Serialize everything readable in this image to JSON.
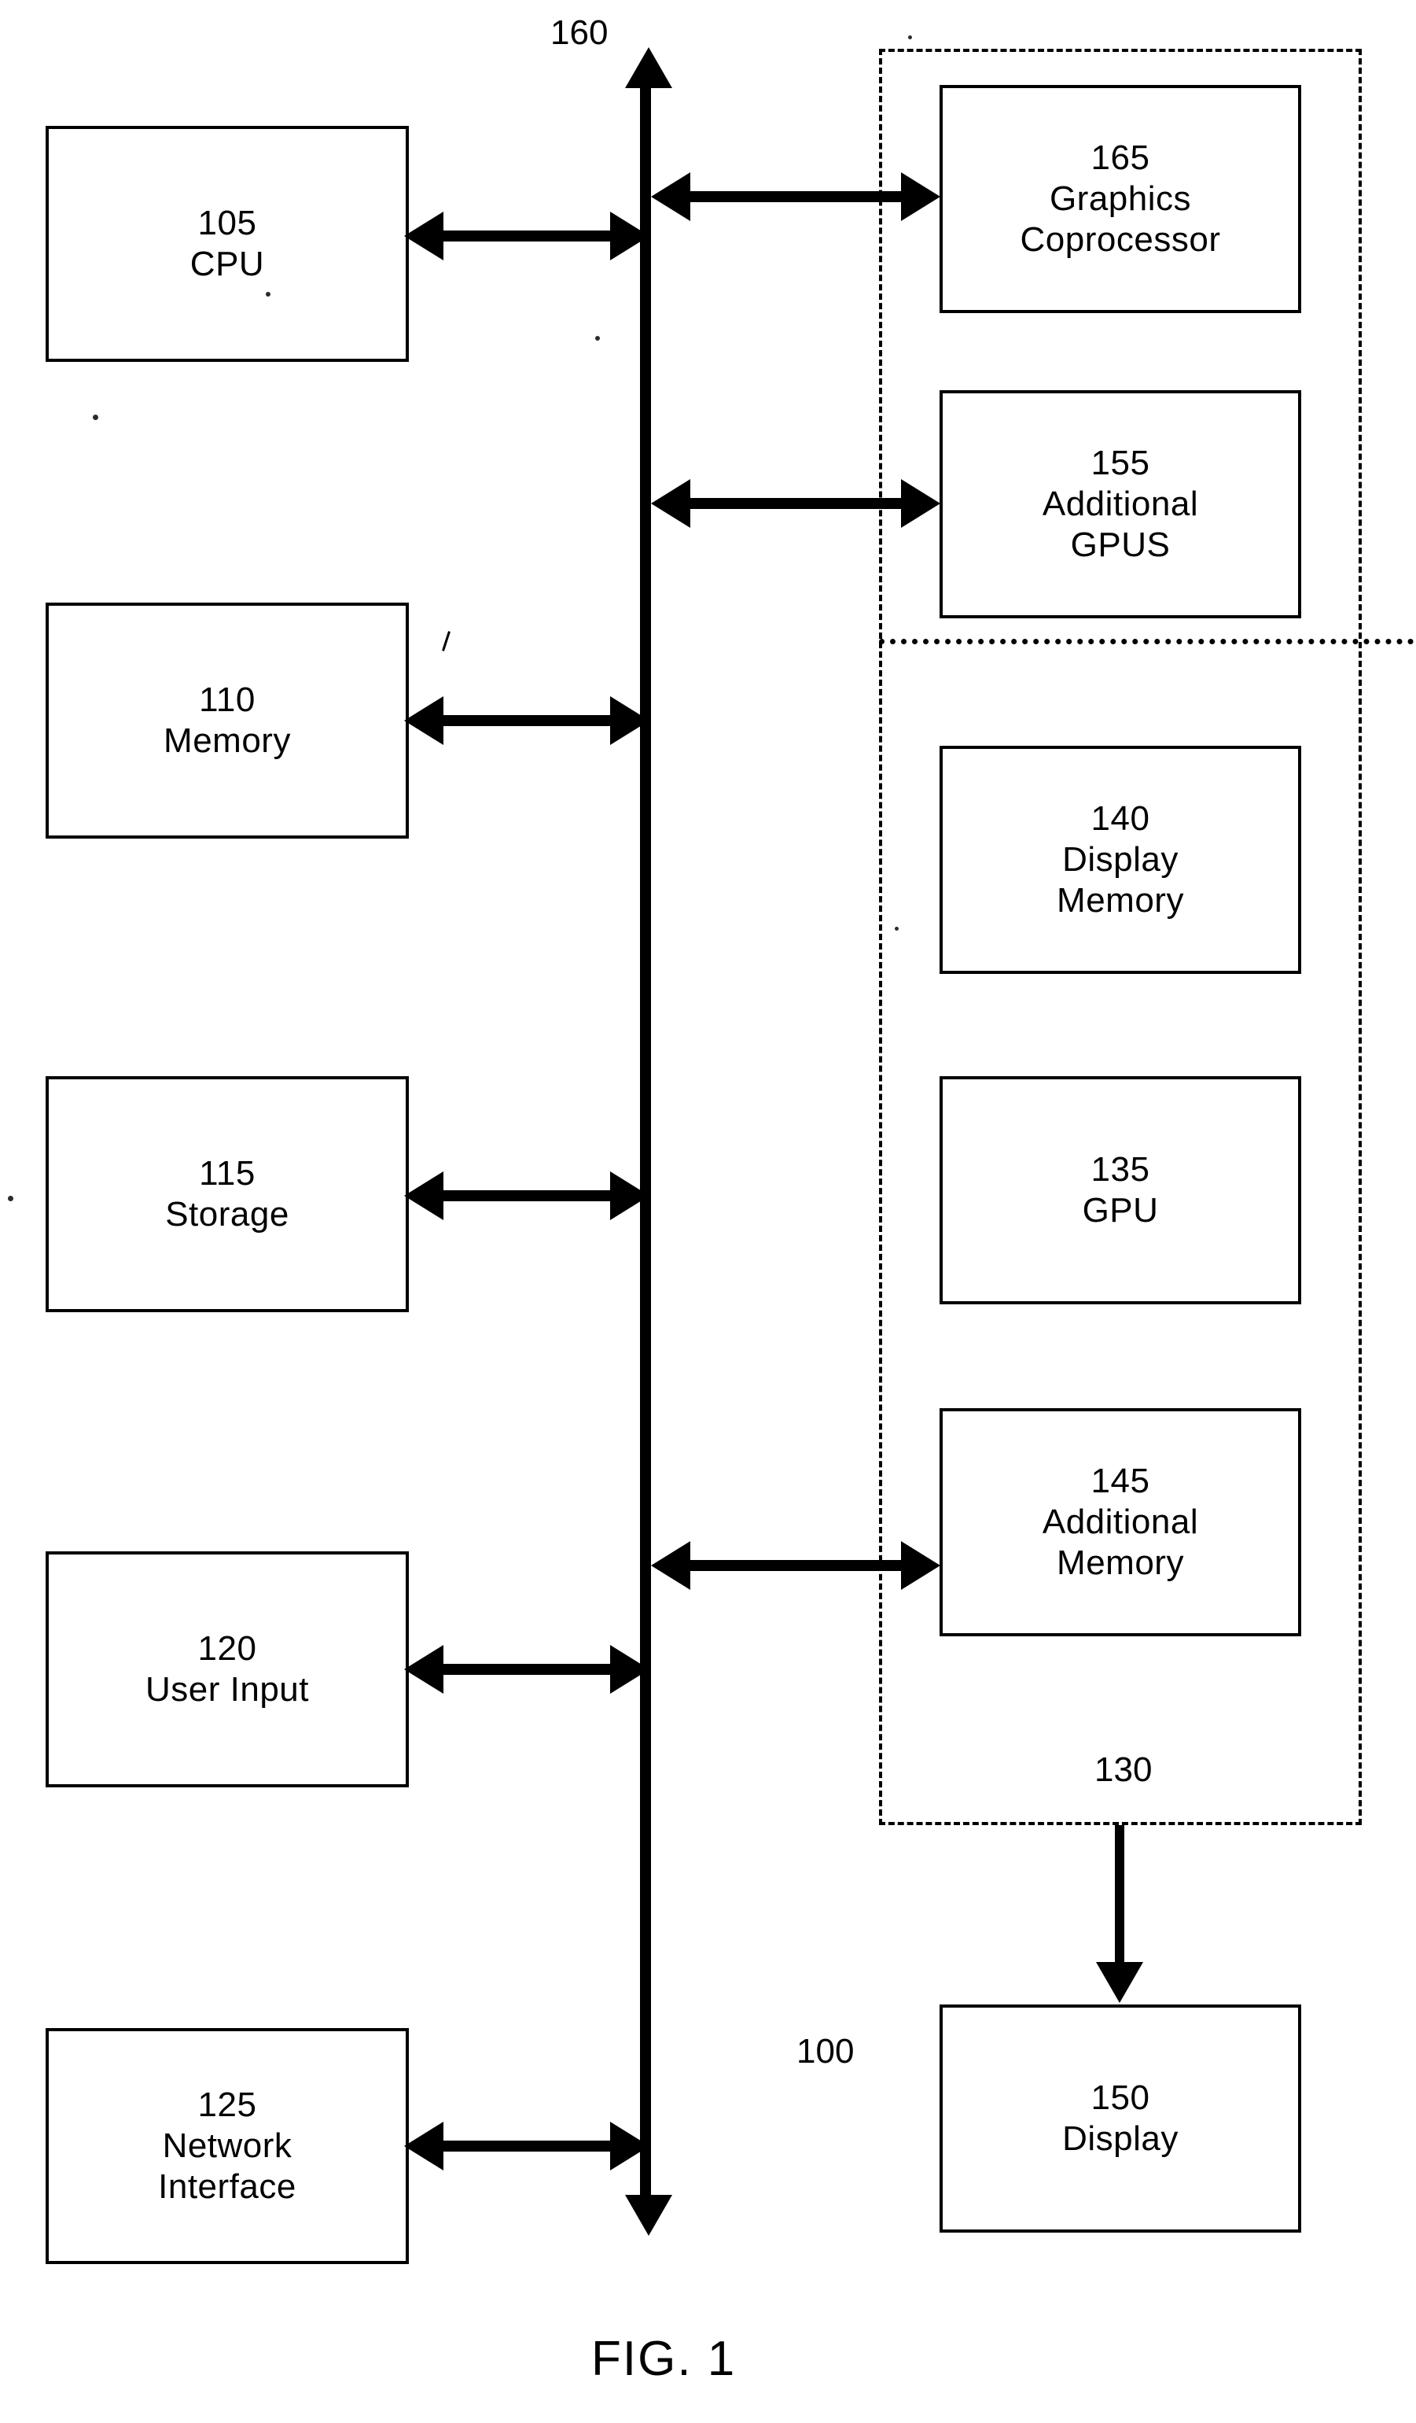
{
  "figure": {
    "caption": "FIG. 1",
    "system_ref": "100",
    "bus_ref": "160",
    "subsystem_ref": "130"
  },
  "host_components": [
    {
      "ref": "105",
      "name": "CPU",
      "name2": ""
    },
    {
      "ref": "110",
      "name": "Memory",
      "name2": ""
    },
    {
      "ref": "115",
      "name": "Storage",
      "name2": ""
    },
    {
      "ref": "120",
      "name": "User Input",
      "name2": ""
    },
    {
      "ref": "125",
      "name": "Network",
      "name2": "Interface"
    }
  ],
  "graphics_subsystem": {
    "ref": "130",
    "above_divider": [
      {
        "ref": "165",
        "name": "Graphics",
        "name2": "Coprocessor"
      },
      {
        "ref": "155",
        "name": "Additional",
        "name2": "GPUS"
      }
    ],
    "below_divider": [
      {
        "ref": "140",
        "name": "Display",
        "name2": "Memory"
      },
      {
        "ref": "135",
        "name": "GPU",
        "name2": ""
      },
      {
        "ref": "145",
        "name": "Additional",
        "name2": "Memory"
      }
    ]
  },
  "output": {
    "ref": "150",
    "name": "Display",
    "name2": ""
  },
  "colors": {
    "ink": "#000000",
    "paper": "#ffffff"
  }
}
